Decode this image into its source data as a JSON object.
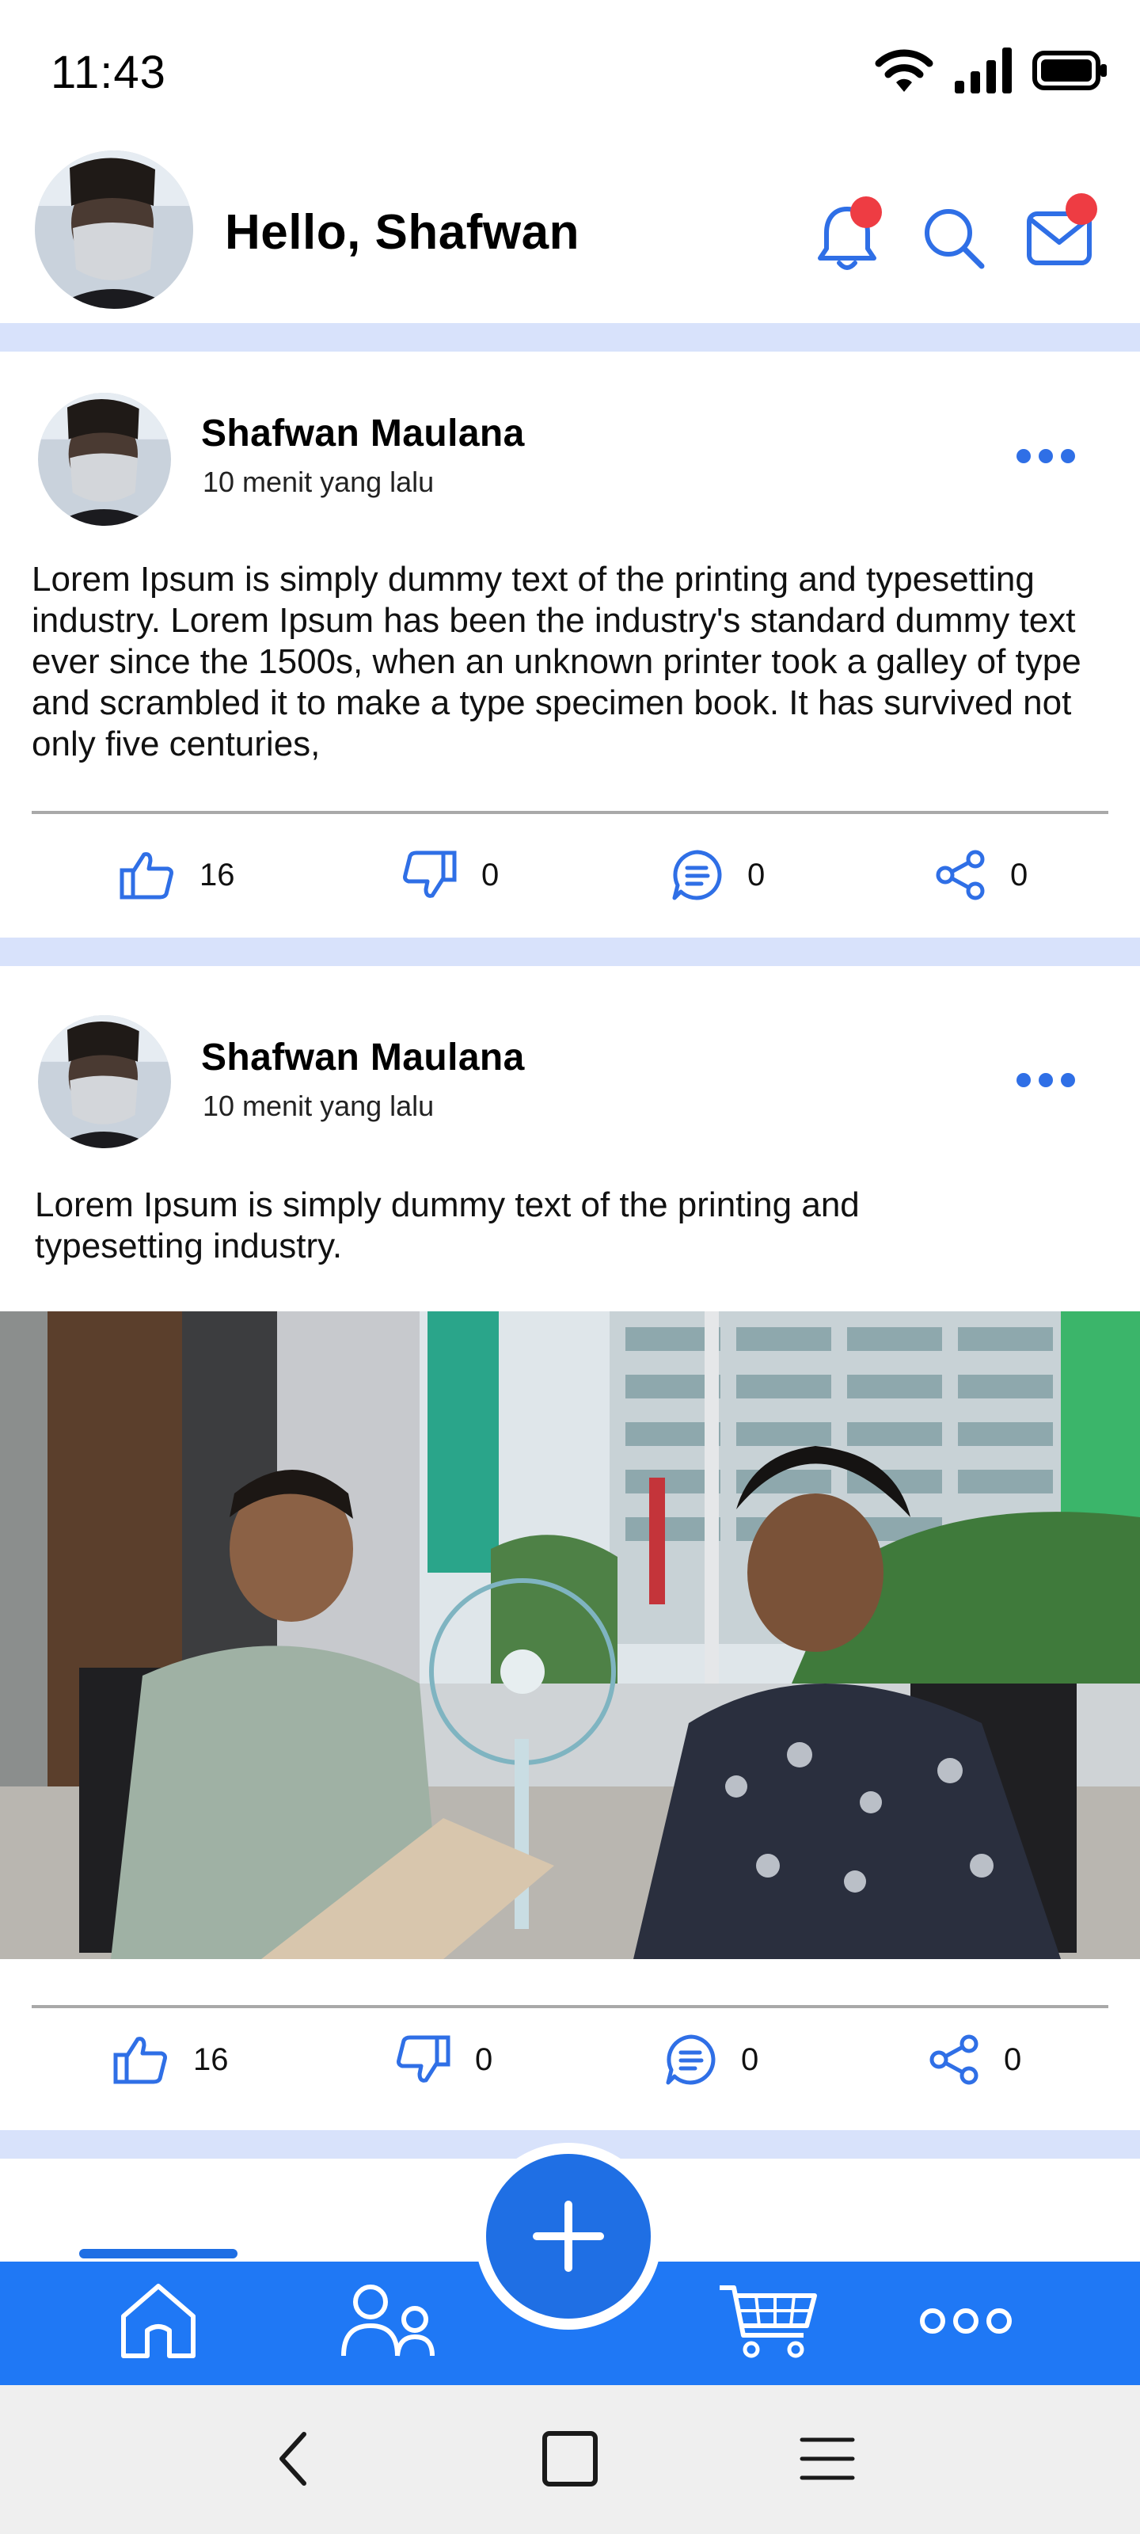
{
  "status_bar": {
    "time": "11:43"
  },
  "header": {
    "greeting": "Hello, Shafwan"
  },
  "posts": [
    {
      "author": "Shafwan Maulana",
      "time": "10 menit yang lalu",
      "text": "Lorem Ipsum is simply dummy text of the printing and typesetting industry. Lorem Ipsum has been the industry's standard dummy text ever since the 1500s, when an unknown printer took a galley of type and scrambled it to make a type specimen book. It has survived not only five centuries,",
      "likes": "16",
      "dislikes": "0",
      "comments": "0",
      "shares": "0"
    },
    {
      "author": "Shafwan Maulana",
      "time": "10 menit yang lalu",
      "text": "Lorem Ipsum is simply dummy text of the printing and typesetting industry.",
      "likes": "16",
      "dislikes": "0",
      "comments": "0",
      "shares": "0"
    }
  ],
  "bottom_nav": {
    "items": [
      "home-icon",
      "friends-icon",
      "cart-icon",
      "more-icon"
    ],
    "active": "home",
    "fab_icon": "plus-icon"
  },
  "system_nav": [
    "back-icon",
    "recents-icon",
    "menu-icon"
  ],
  "colors": {
    "accent": "#1f78f5",
    "separator": "#d8e2fb",
    "badge": "#ee3c43"
  }
}
